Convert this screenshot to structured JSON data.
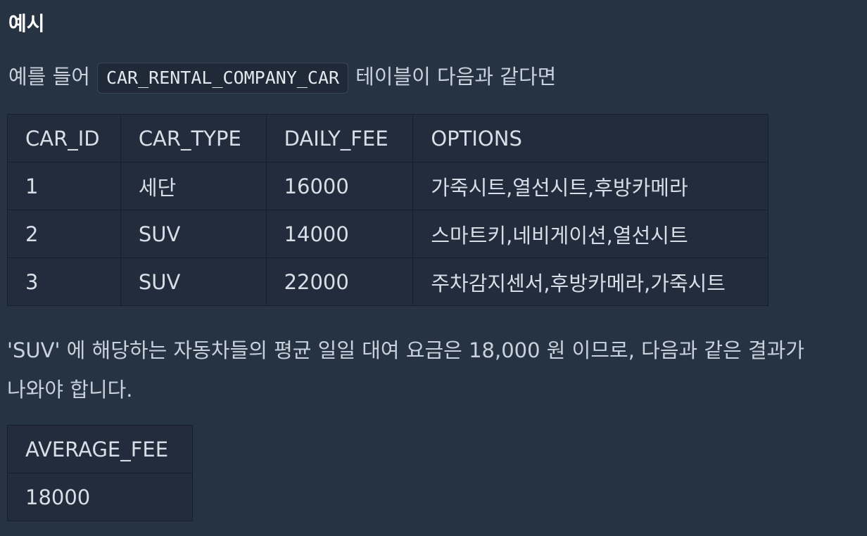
{
  "heading": "예시",
  "intro": {
    "before": "예를 들어",
    "code": "CAR_RENTAL_COMPANY_CAR",
    "after": "테이블이 다음과 같다면"
  },
  "main_table": {
    "headers": [
      "CAR_ID",
      "CAR_TYPE",
      "DAILY_FEE",
      "OPTIONS"
    ],
    "rows": [
      [
        "1",
        "세단",
        "16000",
        "가죽시트,열선시트,후방카메라"
      ],
      [
        "2",
        "SUV",
        "14000",
        "스마트키,네비게이션,열선시트"
      ],
      [
        "3",
        "SUV",
        "22000",
        "주차감지센서,후방카메라,가죽시트"
      ]
    ]
  },
  "paragraph": {
    "line1": "'SUV' 에 해당하는 자동차들의 평균 일일 대여 요금은 18,000 원 이므로, 다음과 같은 결과가",
    "line2": "나와야 합니다."
  },
  "result_table": {
    "header": "AVERAGE_FEE",
    "value": "18000"
  }
}
